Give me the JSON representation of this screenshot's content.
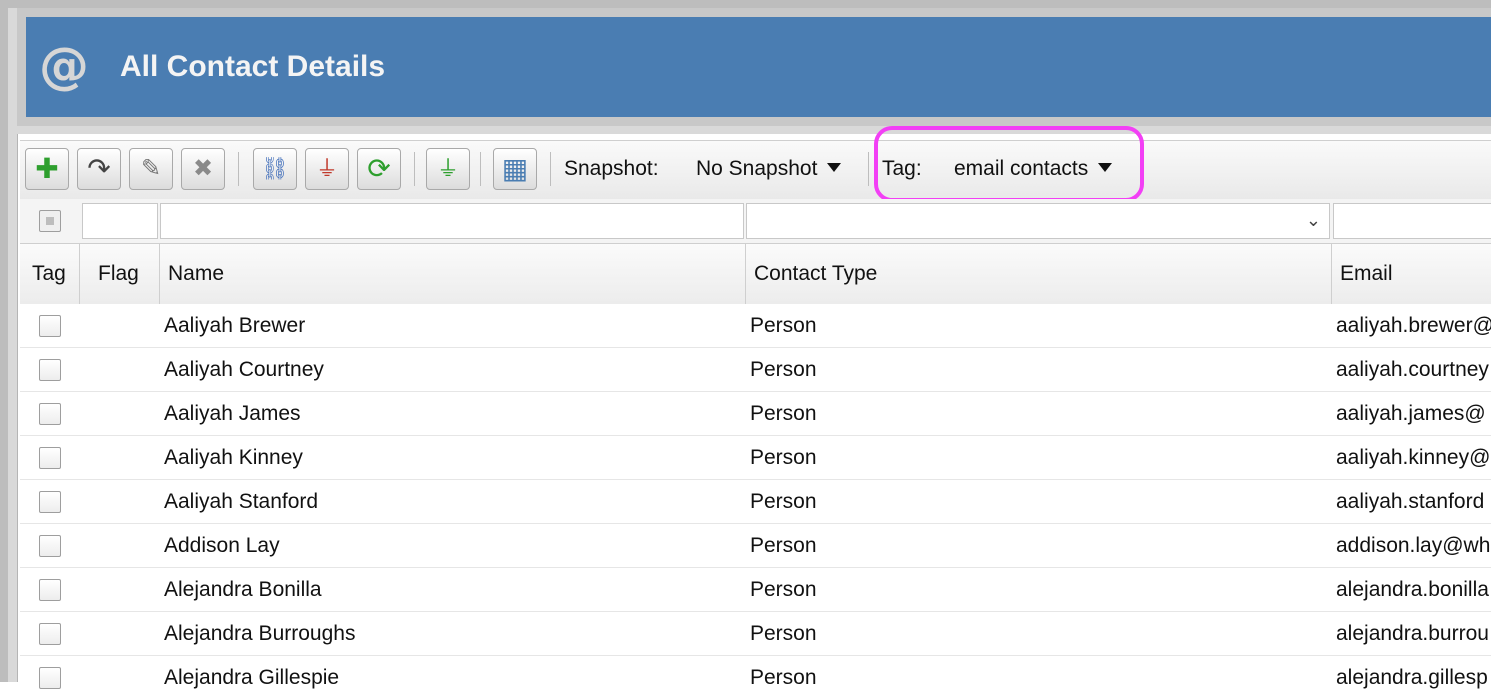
{
  "header": {
    "icon": "at-sign-icon",
    "title": "All Contact Details"
  },
  "toolbar": {
    "buttons": [
      {
        "name": "add-button",
        "icon": "plus-icon",
        "glyph": "✚",
        "color": "#2e9f2e"
      },
      {
        "name": "forward-button",
        "icon": "forward-arrow-icon",
        "glyph": "↷",
        "color": "#555555"
      },
      {
        "name": "edit-button",
        "icon": "pencil-icon",
        "glyph": "✎",
        "color": "#777777"
      },
      {
        "name": "delete-button",
        "icon": "x-icon",
        "glyph": "✖",
        "color": "#888888"
      },
      {
        "name": "link-button",
        "icon": "link-icon",
        "glyph": "⛓",
        "color": "#3a69b8"
      },
      {
        "name": "clear-filter-button",
        "icon": "filter-clear-icon",
        "glyph": "⏚",
        "color": "#c0392b"
      },
      {
        "name": "refresh-button",
        "icon": "refresh-icon",
        "glyph": "⟳",
        "color": "#2e9f2e"
      },
      {
        "name": "filter-button",
        "icon": "filter-icon",
        "glyph": "⏚",
        "color": "#2e9f2e"
      },
      {
        "name": "columns-button",
        "icon": "grid-icon",
        "glyph": "▦",
        "color": "#4a7db2"
      }
    ],
    "snapshot_label": "Snapshot:",
    "snapshot_value": "No Snapshot",
    "tag_label": "Tag:",
    "tag_value": "email contacts"
  },
  "columns": {
    "tag": "Tag",
    "flag": "Flag",
    "name": "Name",
    "contact_type": "Contact Type",
    "email": "Email"
  },
  "rows": [
    {
      "name": "Aaliyah Brewer",
      "type": "Person",
      "email": "aaliyah.brewer@"
    },
    {
      "name": "Aaliyah Courtney",
      "type": "Person",
      "email": "aaliyah.courtney"
    },
    {
      "name": "Aaliyah James",
      "type": "Person",
      "email": "aaliyah.james@"
    },
    {
      "name": "Aaliyah Kinney",
      "type": "Person",
      "email": "aaliyah.kinney@"
    },
    {
      "name": "Aaliyah Stanford",
      "type": "Person",
      "email": "aaliyah.stanford"
    },
    {
      "name": "Addison Lay",
      "type": "Person",
      "email": "addison.lay@wh"
    },
    {
      "name": "Alejandra Bonilla",
      "type": "Person",
      "email": "alejandra.bonilla"
    },
    {
      "name": "Alejandra Burroughs",
      "type": "Person",
      "email": "alejandra.burrou"
    },
    {
      "name": "Alejandra Gillespie",
      "type": "Person",
      "email": "alejandra.gillesp"
    }
  ]
}
